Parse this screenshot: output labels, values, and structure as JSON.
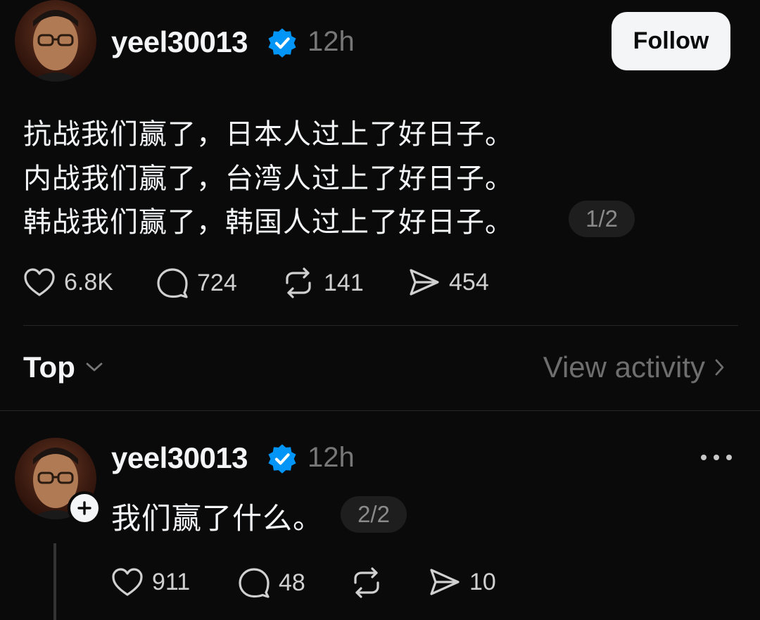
{
  "post": {
    "username": "yeel30013",
    "time": "12h",
    "follow_label": "Follow",
    "lines": [
      "抗战我们赢了，日本人过上了好日子。",
      "内战我们赢了，台湾人过上了好日子。",
      "韩战我们赢了，韩国人过上了好日子。"
    ],
    "page": "1/2",
    "likes": "6.8K",
    "comments": "724",
    "reposts": "141",
    "shares": "454"
  },
  "sort": {
    "label": "Top",
    "view_activity": "View activity"
  },
  "reply": {
    "username": "yeel30013",
    "time": "12h",
    "text": "我们赢了什么。",
    "page": "2/2",
    "likes": "911",
    "comments": "48",
    "reposts": "",
    "shares": "10"
  },
  "colors": {
    "background": "#0a0a0a",
    "verified": "#0095f6",
    "text": "#f3f5f7",
    "muted": "#777777"
  },
  "icons": [
    "heart-icon",
    "comment-icon",
    "repost-icon",
    "share-icon",
    "verified-badge-icon",
    "chevron-down-icon",
    "chevron-right-icon",
    "plus-icon",
    "more-icon"
  ]
}
